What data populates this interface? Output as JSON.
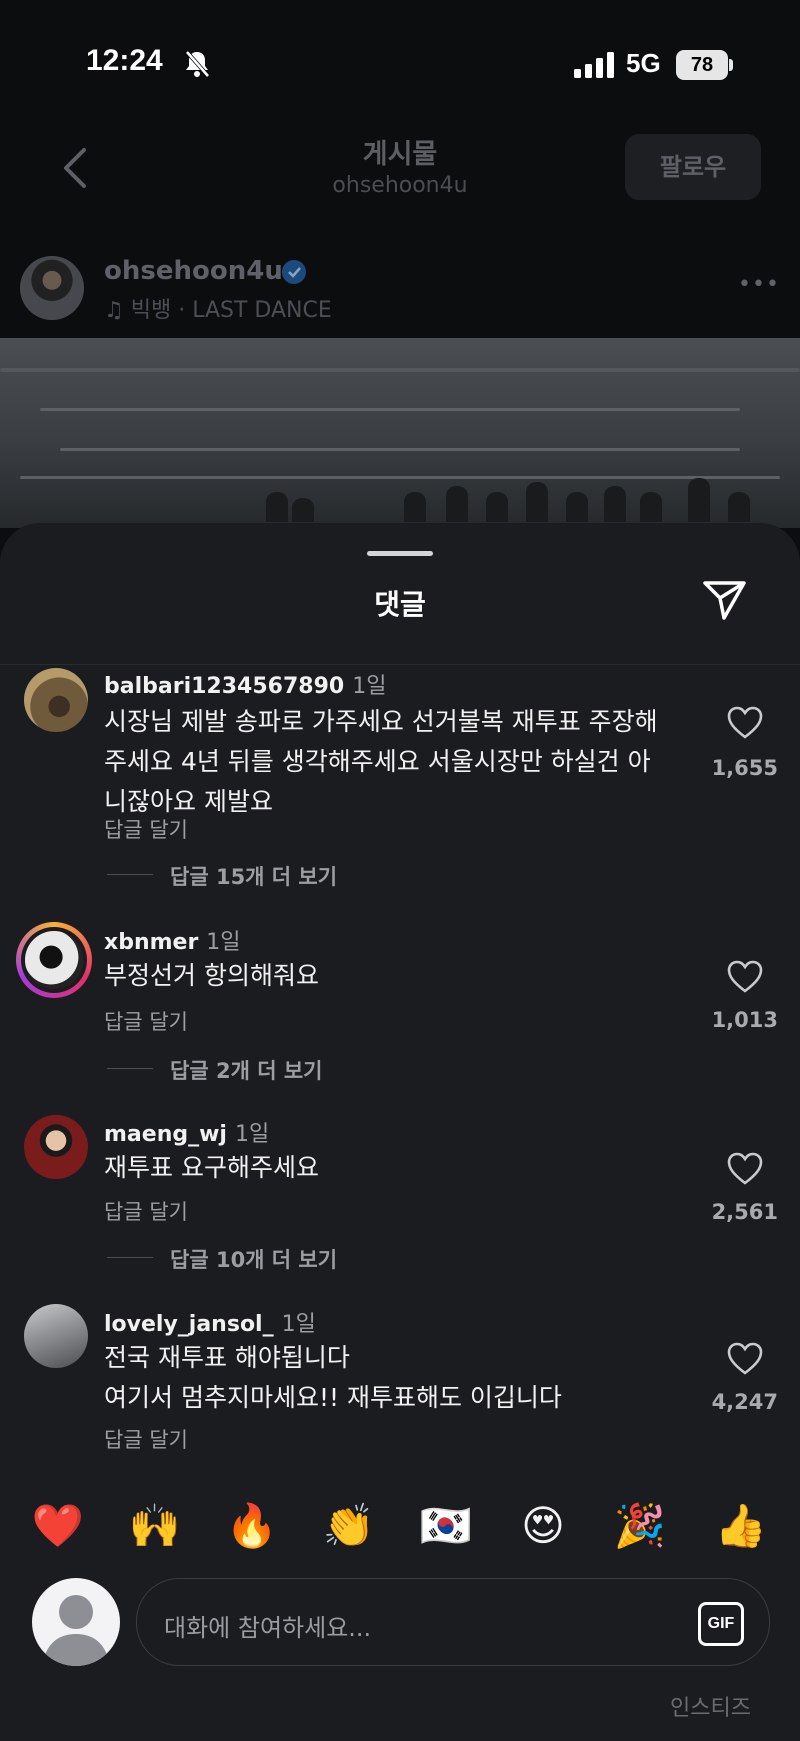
{
  "status_bar": {
    "time": "12:24",
    "network": "5G",
    "battery": "78"
  },
  "header": {
    "title": "게시물",
    "subtitle": "ohsehoon4u",
    "follow_label": "팔로우"
  },
  "post": {
    "username": "ohsehoon4u",
    "music": "빅뱅 · LAST DANCE"
  },
  "sheet": {
    "title": "댓글"
  },
  "comments": [
    {
      "username": "balbari1234567890",
      "time": "1일",
      "lines": [
        "시장님 제발 송파로 가주세요 선거불복 재투표 주장해",
        "주세요 4년 뒤를 생각해주세요 서울시장만 하실건 아",
        "니잖아요 제발요"
      ],
      "reply": "답글 달기",
      "more_replies": "답글 15개 더 보기",
      "likes": "1,655"
    },
    {
      "username": "xbnmer",
      "time": "1일",
      "lines": [
        "부정선거 항의해줘요"
      ],
      "reply": "답글 달기",
      "more_replies": "답글 2개 더 보기",
      "likes": "1,013"
    },
    {
      "username": "maeng_wj",
      "time": "1일",
      "lines": [
        "재투표 요구해주세요"
      ],
      "reply": "답글 달기",
      "more_replies": "답글 10개 더 보기",
      "likes": "2,561"
    },
    {
      "username": "lovely_jansol_",
      "time": "1일",
      "lines": [
        "전국 재투표 해야됩니다",
        "여기서 멈추지마세요!! 재투표해도 이깁니다"
      ],
      "reply": "답글 달기",
      "likes": "4,247"
    }
  ],
  "emoji_reactions": [
    "❤️",
    "🙌",
    "🔥",
    "👏",
    "🇰🇷",
    "😍",
    "🎉",
    "👍"
  ],
  "composer": {
    "placeholder": "대화에 참여하세요...",
    "gif_label": "GIF"
  },
  "watermark": "인스티즈"
}
